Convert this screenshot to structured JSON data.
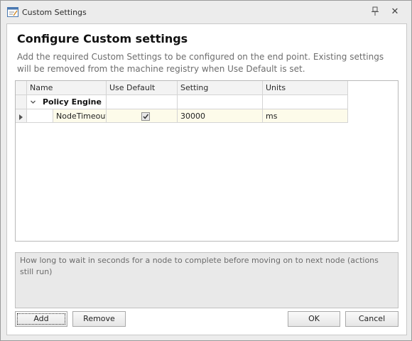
{
  "window": {
    "title": "Custom Settings"
  },
  "titlebar_buttons": {
    "pin_icon": "pin-icon",
    "close_glyph": "✕"
  },
  "content": {
    "heading": "Configure Custom settings",
    "description": "Add the required Custom Settings to be configured on the end point. Existing settings will be removed from the machine registry when Use Default is set."
  },
  "grid": {
    "columns": [
      "Name",
      "Use Default",
      "Setting",
      "Units"
    ],
    "group": {
      "label": "Policy Engine",
      "expanded": true
    },
    "rows": [
      {
        "name": "NodeTimeout",
        "use_default": true,
        "setting": "30000",
        "units": "ms"
      }
    ]
  },
  "hint": {
    "text": "How long to wait in seconds for a node to complete before moving on to next node (actions still run)"
  },
  "buttons": {
    "add": "Add",
    "remove": "Remove",
    "ok": "OK",
    "cancel": "Cancel"
  },
  "colors": {
    "selected_row": "#fdfbea",
    "header_bg": "#f3f3f3"
  }
}
